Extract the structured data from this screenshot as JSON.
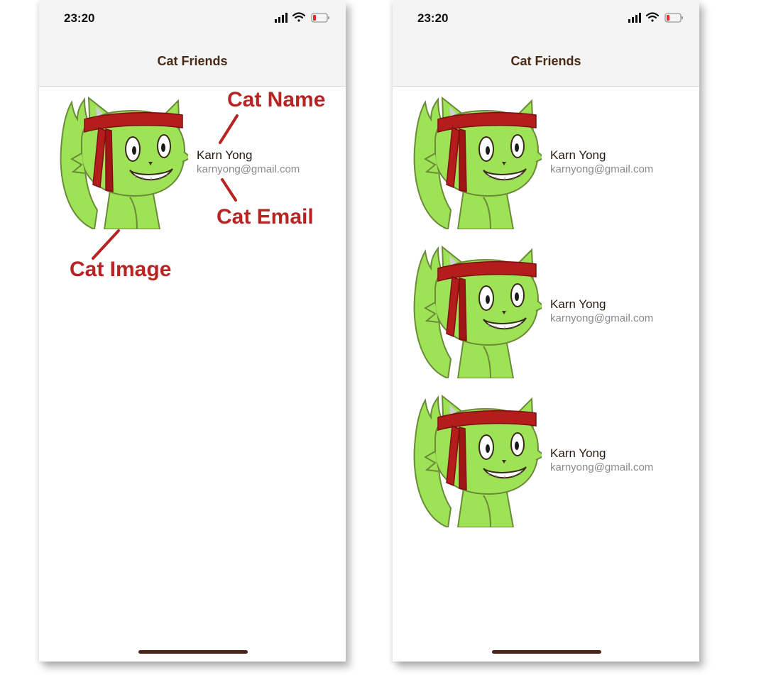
{
  "status_bar": {
    "time": "23:20",
    "icons": [
      "signal-icon",
      "wifi-icon",
      "battery-icon"
    ],
    "battery_color": "#e02b2b"
  },
  "app": {
    "title": "Cat Friends",
    "title_color": "#4a2a14"
  },
  "cats": [
    {
      "name": "Karn Yong",
      "email": "karnyong@gmail.com",
      "image": "cat-image"
    }
  ],
  "cats_list": [
    {
      "name": "Karn Yong",
      "email": "karnyong@gmail.com",
      "image": "cat-image"
    },
    {
      "name": "Karn Yong",
      "email": "karnyong@gmail.com",
      "image": "cat-image"
    },
    {
      "name": "Karn Yong",
      "email": "karnyong@gmail.com",
      "image": "cat-image"
    }
  ],
  "annotations": {
    "cat_name": "Cat Name",
    "cat_email": "Cat Email",
    "cat_image": "Cat Image",
    "color": "#b82424"
  },
  "colors": {
    "cat_fill": "#9ee356",
    "cat_outline": "#6b8a3a",
    "headband": "#b51c1c"
  }
}
